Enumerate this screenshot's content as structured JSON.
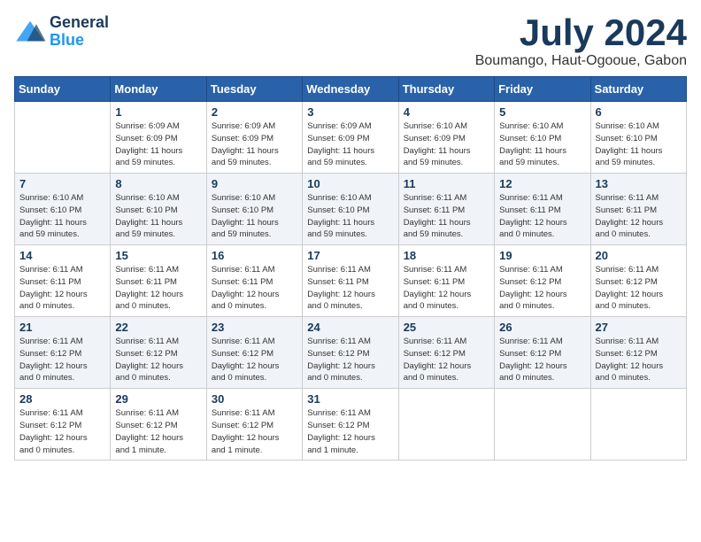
{
  "logo": {
    "line1": "General",
    "line2": "Blue"
  },
  "title": "July 2024",
  "location": "Boumango, Haut-Ogooue, Gabon",
  "weekdays": [
    "Sunday",
    "Monday",
    "Tuesday",
    "Wednesday",
    "Thursday",
    "Friday",
    "Saturday"
  ],
  "weeks": [
    [
      {
        "day": "",
        "info": ""
      },
      {
        "day": "1",
        "info": "Sunrise: 6:09 AM\nSunset: 6:09 PM\nDaylight: 11 hours\nand 59 minutes."
      },
      {
        "day": "2",
        "info": "Sunrise: 6:09 AM\nSunset: 6:09 PM\nDaylight: 11 hours\nand 59 minutes."
      },
      {
        "day": "3",
        "info": "Sunrise: 6:09 AM\nSunset: 6:09 PM\nDaylight: 11 hours\nand 59 minutes."
      },
      {
        "day": "4",
        "info": "Sunrise: 6:10 AM\nSunset: 6:09 PM\nDaylight: 11 hours\nand 59 minutes."
      },
      {
        "day": "5",
        "info": "Sunrise: 6:10 AM\nSunset: 6:10 PM\nDaylight: 11 hours\nand 59 minutes."
      },
      {
        "day": "6",
        "info": "Sunrise: 6:10 AM\nSunset: 6:10 PM\nDaylight: 11 hours\nand 59 minutes."
      }
    ],
    [
      {
        "day": "7",
        "info": "Sunrise: 6:10 AM\nSunset: 6:10 PM\nDaylight: 11 hours\nand 59 minutes."
      },
      {
        "day": "8",
        "info": "Sunrise: 6:10 AM\nSunset: 6:10 PM\nDaylight: 11 hours\nand 59 minutes."
      },
      {
        "day": "9",
        "info": "Sunrise: 6:10 AM\nSunset: 6:10 PM\nDaylight: 11 hours\nand 59 minutes."
      },
      {
        "day": "10",
        "info": "Sunrise: 6:10 AM\nSunset: 6:10 PM\nDaylight: 11 hours\nand 59 minutes."
      },
      {
        "day": "11",
        "info": "Sunrise: 6:11 AM\nSunset: 6:11 PM\nDaylight: 11 hours\nand 59 minutes."
      },
      {
        "day": "12",
        "info": "Sunrise: 6:11 AM\nSunset: 6:11 PM\nDaylight: 12 hours\nand 0 minutes."
      },
      {
        "day": "13",
        "info": "Sunrise: 6:11 AM\nSunset: 6:11 PM\nDaylight: 12 hours\nand 0 minutes."
      }
    ],
    [
      {
        "day": "14",
        "info": "Sunrise: 6:11 AM\nSunset: 6:11 PM\nDaylight: 12 hours\nand 0 minutes."
      },
      {
        "day": "15",
        "info": "Sunrise: 6:11 AM\nSunset: 6:11 PM\nDaylight: 12 hours\nand 0 minutes."
      },
      {
        "day": "16",
        "info": "Sunrise: 6:11 AM\nSunset: 6:11 PM\nDaylight: 12 hours\nand 0 minutes."
      },
      {
        "day": "17",
        "info": "Sunrise: 6:11 AM\nSunset: 6:11 PM\nDaylight: 12 hours\nand 0 minutes."
      },
      {
        "day": "18",
        "info": "Sunrise: 6:11 AM\nSunset: 6:11 PM\nDaylight: 12 hours\nand 0 minutes."
      },
      {
        "day": "19",
        "info": "Sunrise: 6:11 AM\nSunset: 6:12 PM\nDaylight: 12 hours\nand 0 minutes."
      },
      {
        "day": "20",
        "info": "Sunrise: 6:11 AM\nSunset: 6:12 PM\nDaylight: 12 hours\nand 0 minutes."
      }
    ],
    [
      {
        "day": "21",
        "info": "Sunrise: 6:11 AM\nSunset: 6:12 PM\nDaylight: 12 hours\nand 0 minutes."
      },
      {
        "day": "22",
        "info": "Sunrise: 6:11 AM\nSunset: 6:12 PM\nDaylight: 12 hours\nand 0 minutes."
      },
      {
        "day": "23",
        "info": "Sunrise: 6:11 AM\nSunset: 6:12 PM\nDaylight: 12 hours\nand 0 minutes."
      },
      {
        "day": "24",
        "info": "Sunrise: 6:11 AM\nSunset: 6:12 PM\nDaylight: 12 hours\nand 0 minutes."
      },
      {
        "day": "25",
        "info": "Sunrise: 6:11 AM\nSunset: 6:12 PM\nDaylight: 12 hours\nand 0 minutes."
      },
      {
        "day": "26",
        "info": "Sunrise: 6:11 AM\nSunset: 6:12 PM\nDaylight: 12 hours\nand 0 minutes."
      },
      {
        "day": "27",
        "info": "Sunrise: 6:11 AM\nSunset: 6:12 PM\nDaylight: 12 hours\nand 0 minutes."
      }
    ],
    [
      {
        "day": "28",
        "info": "Sunrise: 6:11 AM\nSunset: 6:12 PM\nDaylight: 12 hours\nand 0 minutes."
      },
      {
        "day": "29",
        "info": "Sunrise: 6:11 AM\nSunset: 6:12 PM\nDaylight: 12 hours\nand 1 minute."
      },
      {
        "day": "30",
        "info": "Sunrise: 6:11 AM\nSunset: 6:12 PM\nDaylight: 12 hours\nand 1 minute."
      },
      {
        "day": "31",
        "info": "Sunrise: 6:11 AM\nSunset: 6:12 PM\nDaylight: 12 hours\nand 1 minute."
      },
      {
        "day": "",
        "info": ""
      },
      {
        "day": "",
        "info": ""
      },
      {
        "day": "",
        "info": ""
      }
    ]
  ]
}
